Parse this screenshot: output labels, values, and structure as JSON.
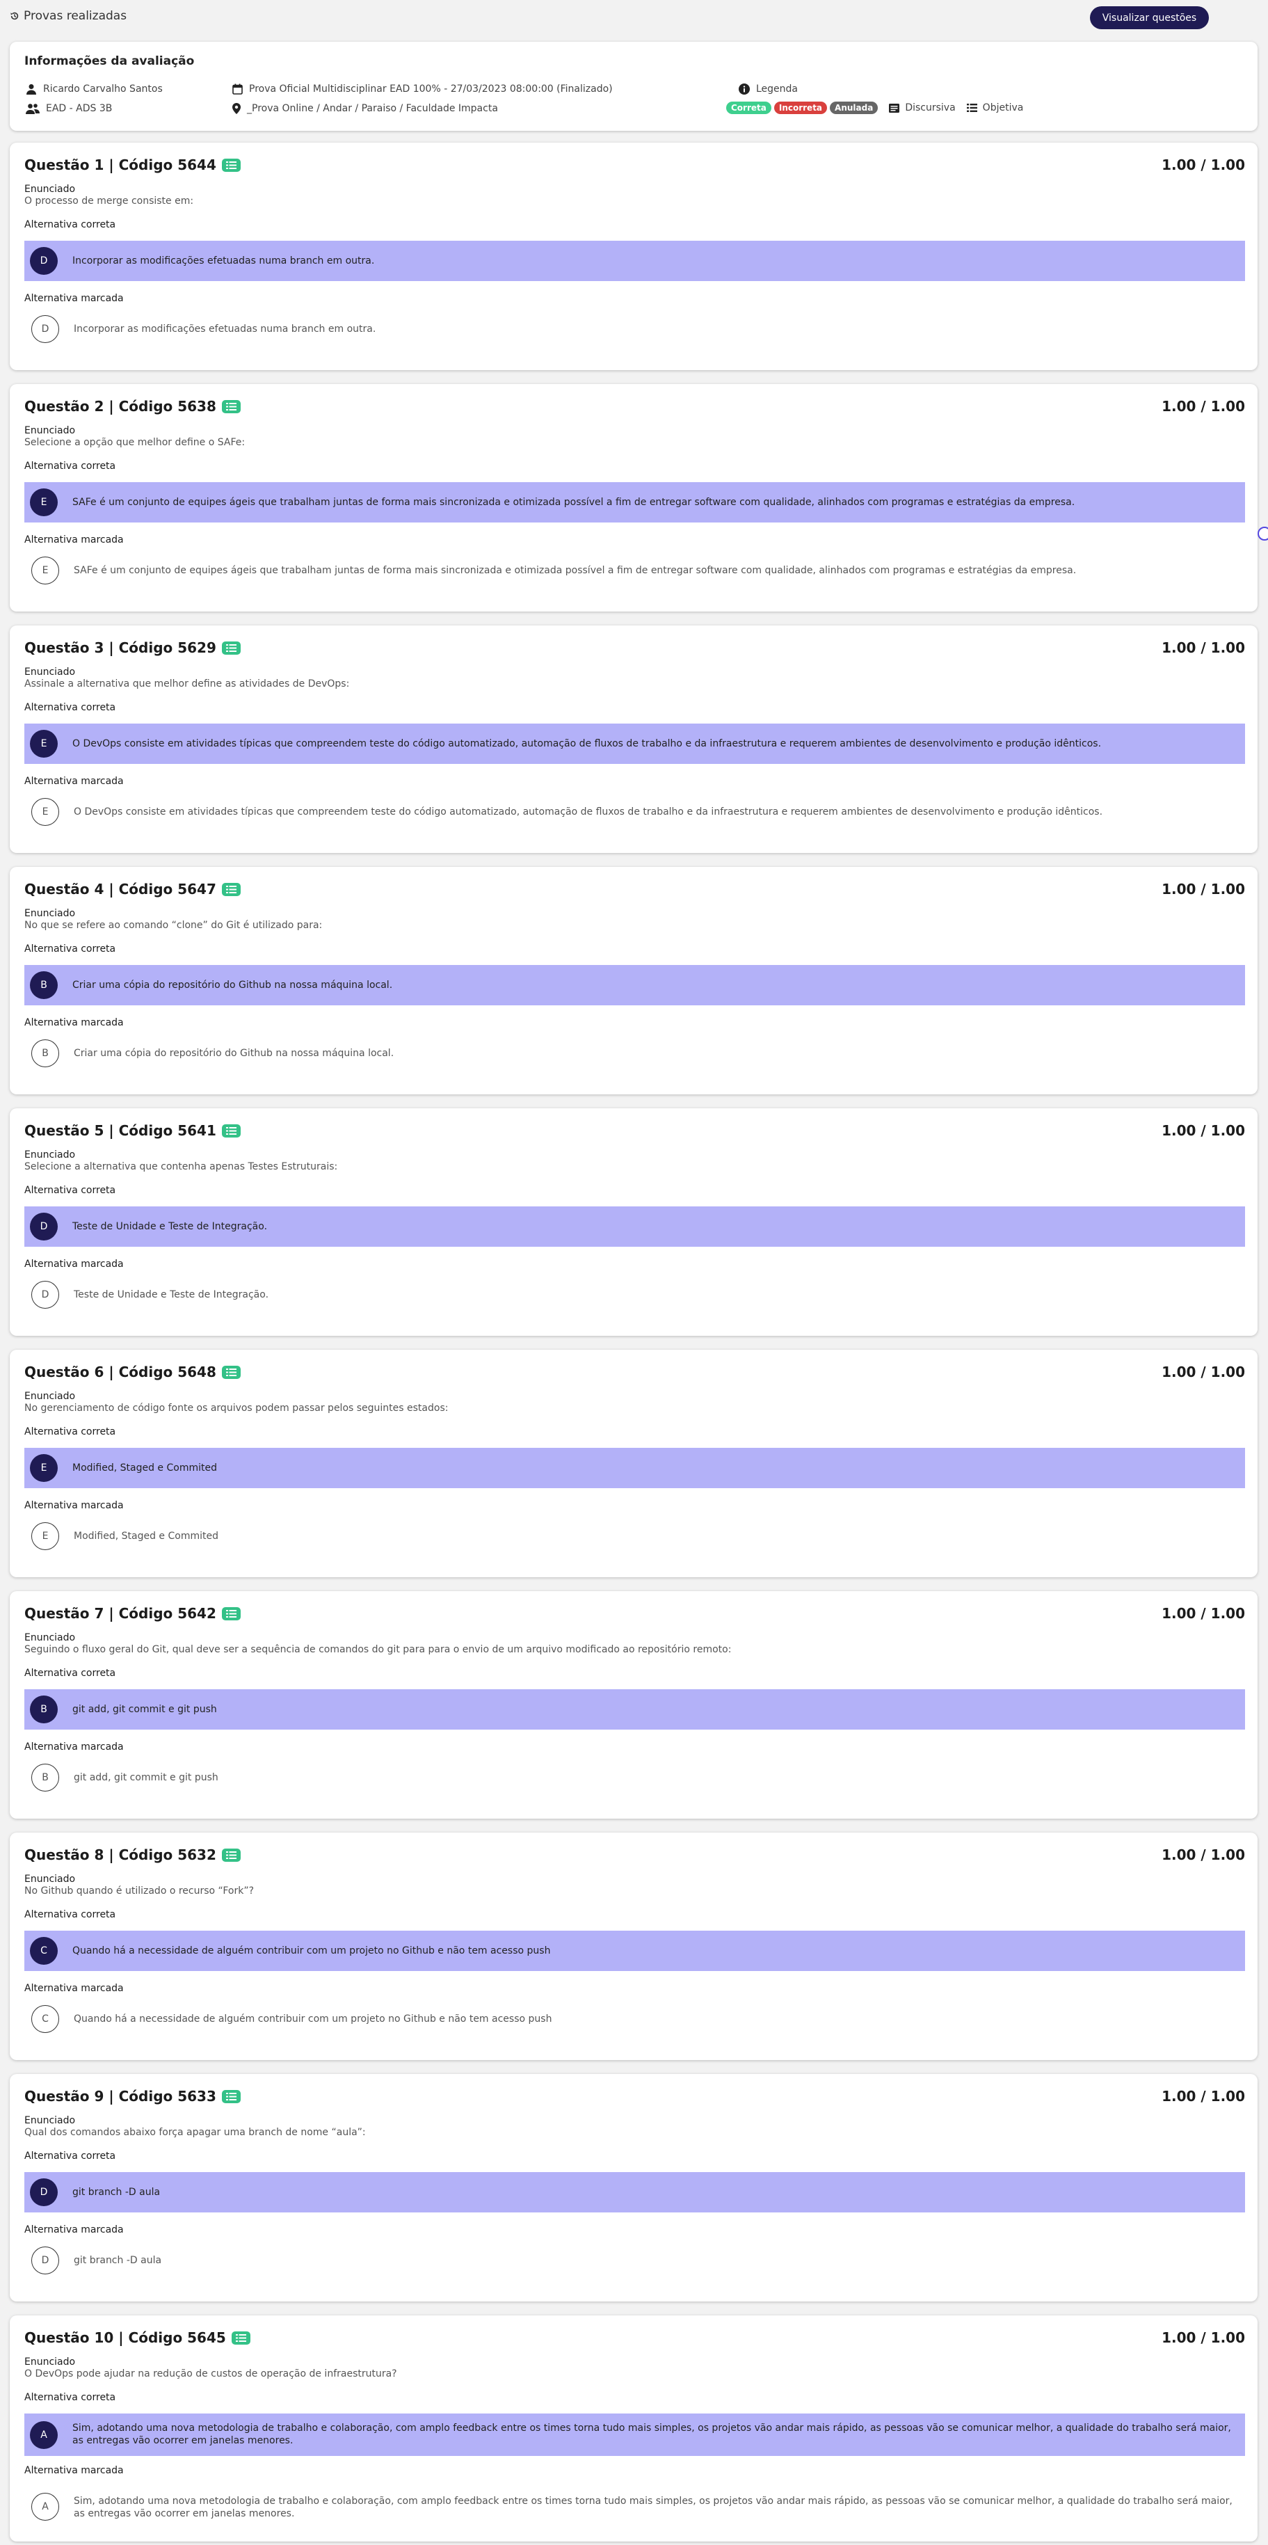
{
  "topbar": {
    "back_label": "Provas realizadas",
    "view_button": "Visualizar questões"
  },
  "info": {
    "title": "Informações da avaliação",
    "student": "Ricardo Carvalho Santos",
    "class": "EAD - ADS 3B",
    "exam": "Prova Oficial Multidisciplinar EAD 100% - 27/03/2023 08:00:00 (Finalizado)",
    "location": "_Prova Online / Andar / Paraiso / Faculdade Impacta",
    "legend_label": "Legenda",
    "badges": [
      {
        "label": "Correta",
        "color": "#3ecf8e"
      },
      {
        "label": "Incorreta",
        "color": "#d9403d"
      },
      {
        "label": "Anulada",
        "color": "#666666"
      }
    ],
    "discursive_label": "Discursiva",
    "objective_label": "Objetiva"
  },
  "labels": {
    "statement": "Enunciado",
    "correct": "Alternativa correta",
    "marked": "Alternativa marcada"
  },
  "questions": [
    {
      "title": "Questão 1 | Código 5644",
      "score": "1.00 / 1.00",
      "statement": "O processo de merge consiste em:",
      "correct_letter": "D",
      "correct_text": "Incorporar as modificações efetuadas numa branch em outra.",
      "marked_letter": "D",
      "marked_text": "Incorporar as modificações efetuadas numa branch em outra."
    },
    {
      "title": "Questão 2 | Código 5638",
      "score": "1.00 / 1.00",
      "statement": "Selecione a opção que melhor define o SAFe:",
      "correct_letter": "E",
      "correct_text": "SAFe é um conjunto de equipes ágeis que trabalham juntas de forma mais sincronizada e otimizada possível a fim de entregar software com qualidade, alinhados com programas e estratégias da empresa.",
      "marked_letter": "E",
      "marked_text": "SAFe é um conjunto de equipes ágeis que trabalham juntas de forma mais sincronizada e otimizada possível a fim de entregar software com qualidade, alinhados com programas e estratégias da empresa."
    },
    {
      "title": "Questão 3 | Código 5629",
      "score": "1.00 / 1.00",
      "statement": "Assinale a alternativa que melhor define as atividades de DevOps:",
      "correct_letter": "E",
      "correct_text": "O DevOps consiste em atividades típicas que compreendem teste do código automatizado, automação de fluxos de trabalho e da infraestrutura e requerem ambientes de desenvolvimento e produção idênticos.",
      "marked_letter": "E",
      "marked_text": "O DevOps consiste em atividades típicas que compreendem teste do código automatizado, automação de fluxos de trabalho e da infraestrutura e requerem ambientes de desenvolvimento e produção idênticos."
    },
    {
      "title": "Questão 4 | Código 5647",
      "score": "1.00 / 1.00",
      "statement": "No que se refere ao comando “clone” do Git é utilizado para:",
      "correct_letter": "B",
      "correct_text": "Criar uma cópia do repositório do Github na nossa máquina local.",
      "marked_letter": "B",
      "marked_text": "Criar uma cópia do repositório do Github na nossa máquina local."
    },
    {
      "title": "Questão 5 | Código 5641",
      "score": "1.00 / 1.00",
      "statement": "Selecione a alternativa que contenha apenas Testes Estruturais:",
      "correct_letter": "D",
      "correct_text": "Teste de Unidade e Teste de Integração.",
      "marked_letter": "D",
      "marked_text": "Teste de Unidade e Teste de Integração."
    },
    {
      "title": "Questão 6 | Código 5648",
      "score": "1.00 / 1.00",
      "statement": "No gerenciamento de código fonte os arquivos podem passar pelos seguintes estados:",
      "correct_letter": "E",
      "correct_text": "Modified, Staged e Commited",
      "marked_letter": "E",
      "marked_text": "Modified, Staged e Commited"
    },
    {
      "title": "Questão 7 | Código 5642",
      "score": "1.00 / 1.00",
      "statement": "Seguindo o fluxo geral do Git, qual deve ser a sequência de comandos do git para para o envio de um arquivo modificado ao repositório remoto:",
      "correct_letter": "B",
      "correct_text": "git add, git commit e git push",
      "marked_letter": "B",
      "marked_text": "git add, git commit e git push"
    },
    {
      "title": "Questão 8 | Código 5632",
      "score": "1.00 / 1.00",
      "statement": "No Github quando é utilizado o recurso “Fork”?",
      "correct_letter": "C",
      "correct_text": "Quando há a necessidade de alguém contribuir com um projeto no Github e não tem acesso push",
      "marked_letter": "C",
      "marked_text": "Quando há a necessidade de alguém contribuir com um projeto no Github e não tem acesso push"
    },
    {
      "title": "Questão 9 | Código 5633",
      "score": "1.00 / 1.00",
      "statement": "Qual dos comandos abaixo força apagar uma branch de nome “aula”:",
      "correct_letter": "D",
      "correct_text": "git branch -D aula",
      "marked_letter": "D",
      "marked_text": "git branch -D aula"
    },
    {
      "title": "Questão 10 | Código 5645",
      "score": "1.00 / 1.00",
      "statement": "O DevOps pode ajudar na redução de custos de operação de infraestrutura?",
      "correct_letter": "A",
      "correct_text": "Sim, adotando uma nova metodologia de trabalho e colaboração, com amplo feedback entre os times torna tudo mais simples, os projetos vão andar mais rápido, as pessoas vão se comunicar melhor, a qualidade do trabalho será maior, as entregas vão ocorrer em janelas menores.",
      "marked_letter": "A",
      "marked_text": "Sim, adotando uma nova metodologia de trabalho e colaboração, com amplo feedback entre os times torna tudo mais simples, os projetos vão andar mais rápido, as pessoas vão se comunicar melhor, a qualidade do trabalho será maior, as entregas vão ocorrer em janelas menores."
    }
  ]
}
